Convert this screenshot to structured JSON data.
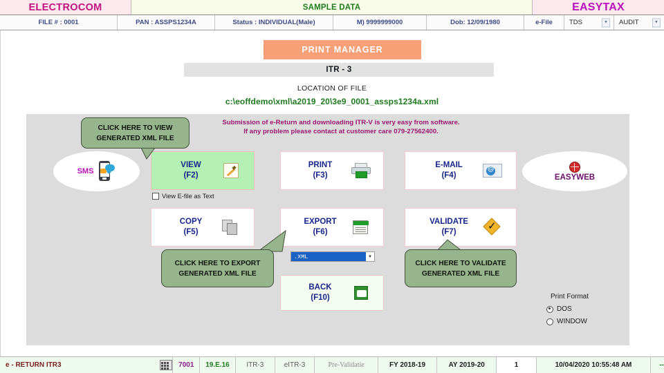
{
  "brand": {
    "left": "ELECTROCOM",
    "middle": "SAMPLE DATA",
    "right": "EASYTAX"
  },
  "info_bar": {
    "file": "FILE # : 0001",
    "pan": "PAN : ASSPS1234A",
    "status": "Status : INDIVIDUAL(Male)",
    "mobile": "M) 9999999000",
    "dob": "Dob: 12/09/1980",
    "efile": "e-File",
    "tds": "TDS",
    "audit": "AUDIT"
  },
  "header": {
    "print_manager": "PRINT MANAGER",
    "form": "ITR - 3",
    "location_label": "LOCATION OF FILE",
    "location_path": "c:\\eoffdemo\\xml\\a2019_20\\3e9_0001_assps1234a.xml"
  },
  "notice": {
    "line1": "Submission of e-Return and downloading ITR-V is very easy from software.",
    "line2": "If any problem please contact at customer care  079-27562400."
  },
  "ovals": {
    "sms": "SMS",
    "easyweb": "EASYWEB"
  },
  "buttons": {
    "view": {
      "label": "VIEW",
      "key": "(F2)"
    },
    "print": {
      "label": "PRINT",
      "key": "(F3)"
    },
    "email": {
      "label": "E-MAIL",
      "key": "(F4)"
    },
    "copy": {
      "label": "COPY",
      "key": "(F5)"
    },
    "export": {
      "label": "EXPORT",
      "key": "(F6)"
    },
    "validate": {
      "label": "VALIDATE",
      "key": "(F7)"
    },
    "back": {
      "label": "BACK",
      "key": "(F10)"
    }
  },
  "controls": {
    "view_as_text": "View E-file as Text",
    "export_format": ".XML",
    "print_format_label": "Print Format",
    "print_format_dos": "DOS",
    "print_format_window": "WINDOW"
  },
  "callouts": {
    "view": "CLICK HERE TO VIEW GENERATED XML FILE",
    "export": "CLICK HERE TO EXPORT GENERATED XML FILE",
    "validate": "CLICK HERE TO VALIDATE GENERATED XML FILE"
  },
  "footer": {
    "title": "e - RETURN ITR3",
    "code": "7001",
    "version": "19.E.16",
    "form": "ITR-3",
    "eform": "eITR-3",
    "stage": "Pre-Validatie",
    "fy": "FY 2018-19",
    "ay": "AY 2019-20",
    "count": "1",
    "datetime": "10/04/2020 10:55:48 AM",
    "extra": "--"
  },
  "colors": {
    "brand_pink": "#fde8ee",
    "brand_magenta": "#c0127f",
    "accent_orange": "#f79f77",
    "green_text": "#1f7a1f",
    "callout_green": "#97b58c",
    "view_green": "#b4f0b4",
    "panel_gray": "#dcdcdc",
    "select_blue": "#1862c6"
  }
}
